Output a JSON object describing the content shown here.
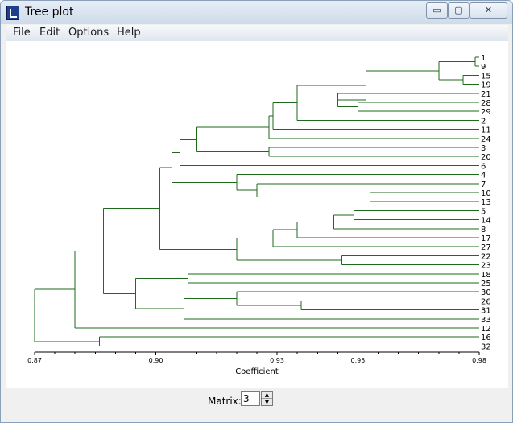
{
  "window": {
    "title": "Tree plot",
    "minimize_glyph": "▭",
    "maximize_glyph": "▢",
    "close_glyph": "✕"
  },
  "menu": [
    "File",
    "Edit",
    "Options",
    "Help"
  ],
  "chart_data": {
    "type": "dendrogram",
    "xlabel": "Coefficient",
    "xlim": [
      0.87,
      0.98
    ],
    "ticks": [
      "0.87",
      "0.90",
      "0.93",
      "0.95",
      "0.98"
    ],
    "tick_values": [
      0.87,
      0.9,
      0.93,
      0.95,
      0.98
    ],
    "leaves": [
      "1",
      "9",
      "15",
      "19",
      "21",
      "28",
      "29",
      "2",
      "11",
      "24",
      "3",
      "20",
      "6",
      "4",
      "7",
      "10",
      "13",
      "5",
      "14",
      "8",
      "17",
      "27",
      "22",
      "23",
      "18",
      "25",
      "30",
      "26",
      "31",
      "33",
      "12",
      "16",
      "32"
    ],
    "merges": [
      [
        "1",
        "9",
        0.979
      ],
      [
        "15",
        "19",
        0.976
      ],
      [
        "1-9",
        "15-19",
        0.97
      ],
      [
        "28",
        "29",
        0.95
      ],
      [
        "21",
        "28-29",
        0.945
      ],
      [
        "1-19",
        "21-29",
        0.952
      ],
      [
        "2",
        "1-29",
        0.935
      ],
      [
        "11",
        "2-29",
        0.929
      ],
      [
        "24",
        "2-29-11",
        0.928
      ],
      [
        "3",
        "20",
        0.928
      ],
      [
        "2-24",
        "3-20",
        0.91
      ],
      [
        "6",
        "2-20",
        0.906
      ],
      [
        "10",
        "13",
        0.953
      ],
      [
        "7",
        "10-13",
        0.925
      ],
      [
        "4",
        "7-13",
        0.92
      ],
      [
        "6-2-20",
        "4-13",
        0.904
      ],
      [
        "5",
        "14",
        0.949
      ],
      [
        "8",
        "5-14",
        0.944
      ],
      [
        "17",
        "5-8",
        0.935
      ],
      [
        "27",
        "17-8",
        0.929
      ],
      [
        "22",
        "23",
        0.946
      ],
      [
        "27-5",
        "22-23",
        0.92
      ],
      [
        "2-13",
        "5-23",
        0.901
      ],
      [
        "18",
        "25",
        0.908
      ],
      [
        "31",
        "26",
        0.936
      ],
      [
        "30",
        "26-31",
        0.92
      ],
      [
        "33",
        "30-31",
        0.907
      ],
      [
        "18-25",
        "30-33",
        0.895
      ],
      [
        "2-23",
        "18-33",
        0.887
      ],
      [
        "12",
        "2-33",
        0.88
      ],
      [
        "16",
        "32",
        0.886
      ],
      [
        "12-33",
        "16-32",
        0.87
      ]
    ]
  },
  "bottom": {
    "matrix_label": "Matrix:",
    "matrix_value": "3",
    "spin_up": "▲",
    "spin_down": "▼"
  }
}
